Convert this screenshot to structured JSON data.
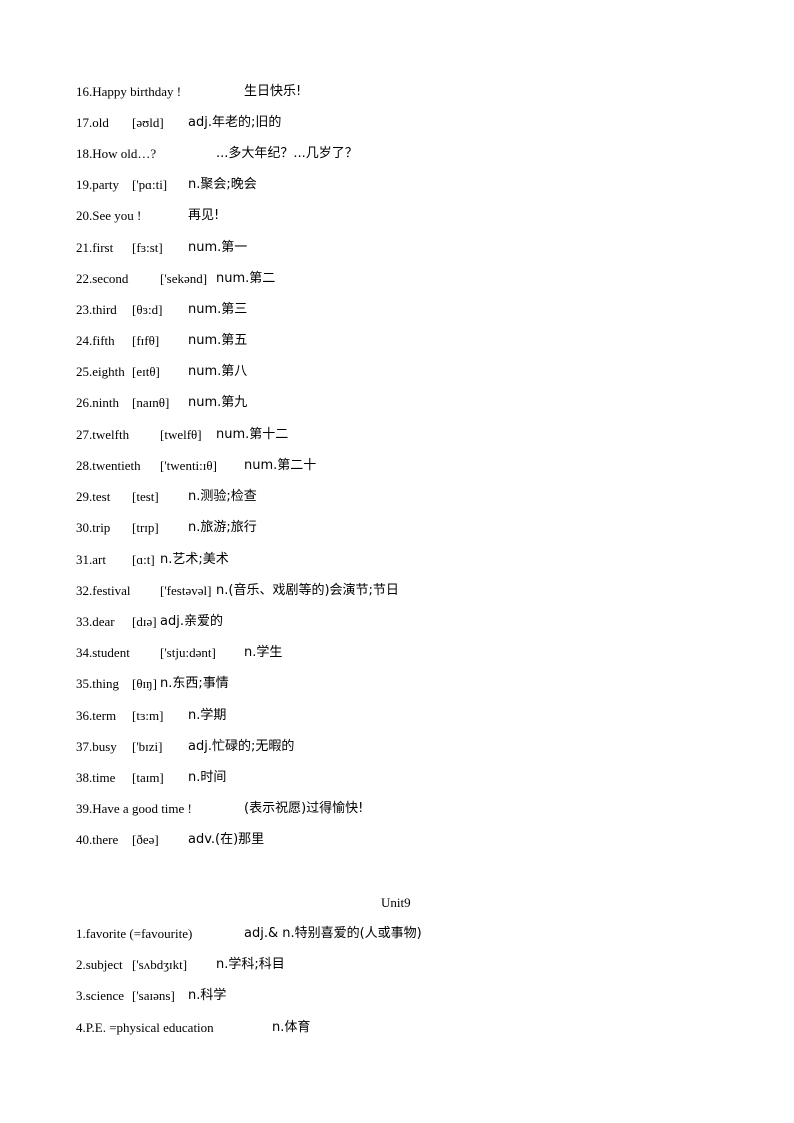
{
  "entries_a": [
    {
      "word": "16.Happy birthday !",
      "phonetic": "",
      "meaning": "生日快乐!"
    },
    {
      "word": "17.old",
      "phonetic": "[əʊld]",
      "meaning": "adj.年老的;旧的"
    },
    {
      "word": "18.How old…?",
      "phonetic": "",
      "meaning": "...多大年纪？...几岁了？"
    },
    {
      "word": "19.party",
      "phonetic": "['pɑ:ti]",
      "meaning": "n.聚会;晚会"
    },
    {
      "word": "20.See you !",
      "phonetic": "",
      "meaning": "再见!"
    },
    {
      "word": "21.first",
      "phonetic": "[fɜ:st]",
      "meaning": "num.第一"
    },
    {
      "word": "22.second",
      "phonetic": "['sekənd]",
      "meaning": "num.第二"
    },
    {
      "word": "23.third",
      "phonetic": "[θɜ:d]",
      "meaning": "num.第三"
    },
    {
      "word": "24.fifth",
      "phonetic": "[fɪfθ]",
      "meaning": "num.第五"
    },
    {
      "word": "25.eighth",
      "phonetic": "[eɪtθ]",
      "meaning": "num.第八"
    },
    {
      "word": "26.ninth",
      "phonetic": "[naɪnθ]",
      "meaning": "num.第九"
    },
    {
      "word": "27.twelfth",
      "phonetic": "[twelfθ]",
      "meaning": "num.第十二"
    },
    {
      "word": "28.twentieth",
      "phonetic": "['twenti:ɪθ]",
      "meaning": "num.第二十"
    },
    {
      "word": "29.test",
      "phonetic": "[test]",
      "meaning": "n.测验;检查"
    },
    {
      "word": "30.trip",
      "phonetic": "[trɪp]",
      "meaning": "n.旅游;旅行"
    },
    {
      "word": "31.art",
      "phonetic": "[ɑ:t]",
      "meaning": "n.艺术;美术"
    },
    {
      "word": "32.festival",
      "phonetic": "['festəvəl]",
      "meaning": "n.(音乐、戏剧等的)会演节;节日"
    },
    {
      "word": "33.dear",
      "phonetic": "[dɪə]",
      "meaning": "adj.亲爱的"
    },
    {
      "word": "34.student",
      "phonetic": "['stju:dənt]",
      "meaning": "n.学生"
    },
    {
      "word": "35.thing",
      "phonetic": "[θɪŋ]",
      "meaning": "n.东西;事情"
    },
    {
      "word": "36.term",
      "phonetic": "[tɜ:m]",
      "meaning": "n.学期"
    },
    {
      "word": "37.busy",
      "phonetic": "['bɪzi]",
      "meaning": "adj.忙碌的;无暇的"
    },
    {
      "word": "38.time",
      "phonetic": "[taɪm]",
      "meaning": "n.时间"
    },
    {
      "word": "39.Have a good time !",
      "phonetic": "",
      "meaning": "(表示祝愿)过得愉快!"
    },
    {
      "word": "40.there",
      "phonetic": "[ðeə]",
      "meaning": "adv.(在)那里"
    }
  ],
  "unit_title": "Unit9",
  "entries_b": [
    {
      "word": "1.favorite (=favourite)",
      "phonetic": "",
      "meaning": "adj.&  n.特别喜爱的(人或事物)"
    },
    {
      "word": "2.subject",
      "phonetic": "['sʌbdʒɪkt]",
      "meaning": "n.学科;科目"
    },
    {
      "word": "3.science",
      "phonetic": "['saɪəns]",
      "meaning": "n.科学"
    },
    {
      "word": "4.P.E. =physical education",
      "phonetic": "",
      "meaning": "n.体育"
    }
  ]
}
